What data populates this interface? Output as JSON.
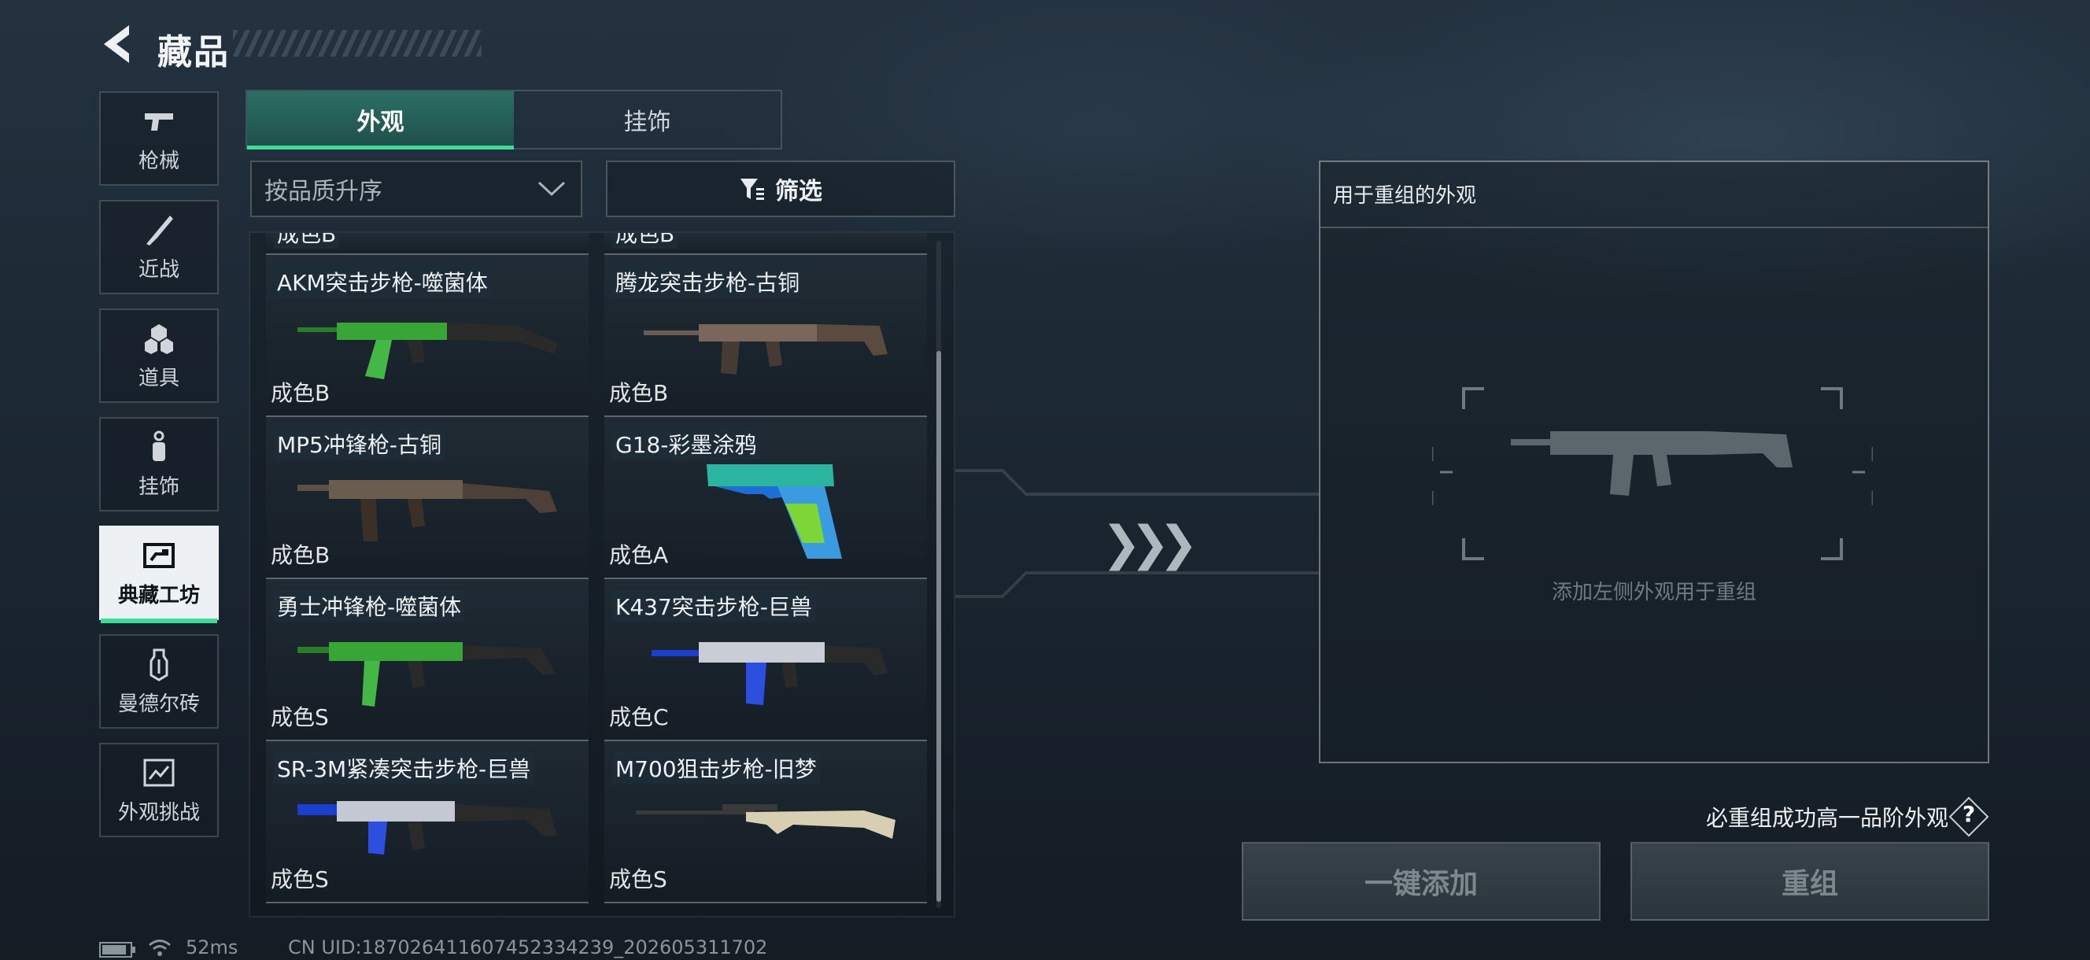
{
  "header": {
    "title": "藏品"
  },
  "sidebar": {
    "items": [
      {
        "label": "枪械",
        "icon": "pistol-icon"
      },
      {
        "label": "近战",
        "icon": "knife-icon"
      },
      {
        "label": "道具",
        "icon": "grenade-icon"
      },
      {
        "label": "挂饰",
        "icon": "charm-icon"
      },
      {
        "label": "典藏工坊",
        "icon": "workshop-icon",
        "active": true
      },
      {
        "label": "曼德尔砖",
        "icon": "brick-icon"
      },
      {
        "label": "外观挑战",
        "icon": "challenge-icon"
      }
    ]
  },
  "tabs": [
    {
      "label": "外观",
      "active": true
    },
    {
      "label": "挂饰",
      "active": false
    }
  ],
  "sort": {
    "selected": "按品质升序"
  },
  "filter": {
    "label": "筛选"
  },
  "grid": {
    "partial_top": [
      "成色B",
      "成色B"
    ],
    "items": [
      {
        "name": "AKM突击步枪-噬菌体",
        "grade": "成色B"
      },
      {
        "name": "腾龙突击步枪-古铜",
        "grade": "成色B"
      },
      {
        "name": "MP5冲锋枪-古铜",
        "grade": "成色B"
      },
      {
        "name": "G18-彩墨涂鸦",
        "grade": "成色A"
      },
      {
        "name": "勇士冲锋枪-噬菌体",
        "grade": "成色S"
      },
      {
        "name": "K437突击步枪-巨兽",
        "grade": "成色C"
      },
      {
        "name": "SR-3M紧凑突击步枪-巨兽",
        "grade": "成色S"
      },
      {
        "name": "M700狙击步枪-旧梦",
        "grade": "成色S"
      }
    ]
  },
  "recombine": {
    "title": "用于重组的外观",
    "hint": "添加左侧外观用于重组",
    "note": "必重组成功高一品阶外观",
    "help": "?",
    "add_all_label": "一键添加",
    "recombine_label": "重组"
  },
  "status": {
    "ping": "52ms",
    "uid": "CN UID:187026411607452334239_202605311702"
  },
  "colors": {
    "accent": "#3ddc97",
    "active_tab": "#2c6f65"
  }
}
